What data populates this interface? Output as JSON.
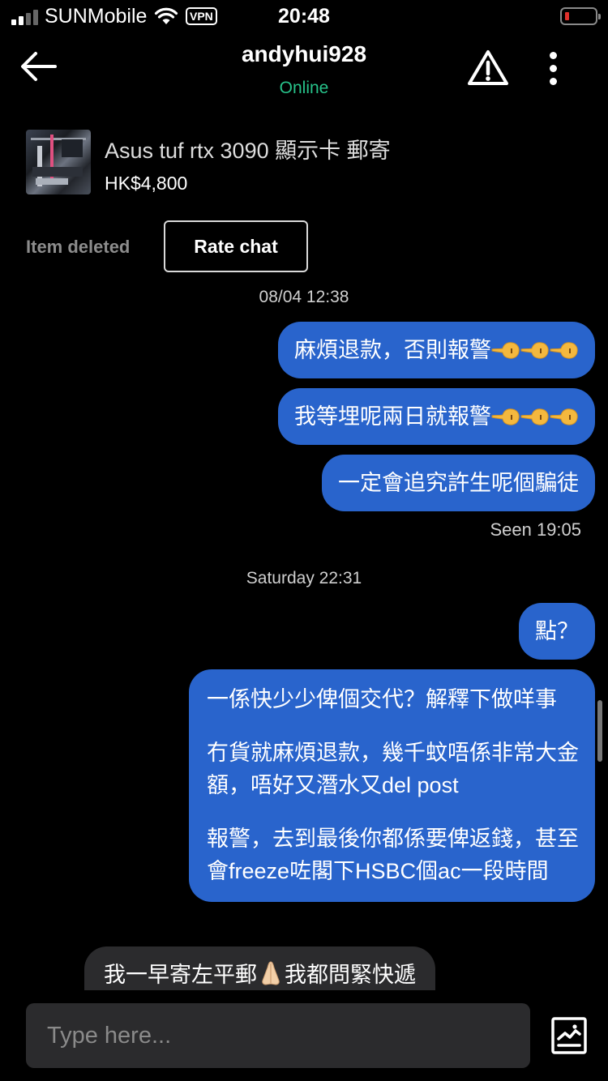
{
  "status_bar": {
    "carrier": "SUNMobile",
    "vpn": "VPN",
    "time": "20:48",
    "battery_level": 0.08,
    "battery_color": "#e0302b"
  },
  "header": {
    "username": "andyhui928",
    "status": "Online",
    "status_color": "#27c28a",
    "icons": [
      "back-arrow-icon",
      "warning-icon",
      "more-vertical-icon"
    ]
  },
  "listing": {
    "title": "Asus tuf rtx 3090 顯示卡 郵寄",
    "price": "HK$4,800",
    "status": "Item deleted",
    "rate_button": "Rate chat"
  },
  "conversation": {
    "separator1": "08/04 12:38",
    "msg1": "麻煩退款，否則報警",
    "msg2": "我等埋呢兩日就報警",
    "msg3": "一定會追究許生呢個騙徒",
    "seen": "Seen 19:05",
    "separator2": "Saturday 22:31",
    "msg4": "點？",
    "msg5": {
      "line1": "一係快少少俾個交代？解釋下做咩事",
      "line2": "冇貨就麻煩退款，幾千蚊唔係非常大金",
      "line3": "額，唔好又潛水又del post",
      "line4": "報警，去到最後你都係要俾返錢，甚至",
      "line5": "會freeze咗閣下HSBC個ac一段時間"
    },
    "msg6": "我一早寄左平郵",
    "msg6_tail": "我都問緊快遞",
    "outgoing_color": "#2964cc",
    "incoming_color": "#2b2b2d"
  },
  "input": {
    "placeholder": "Type here..."
  }
}
